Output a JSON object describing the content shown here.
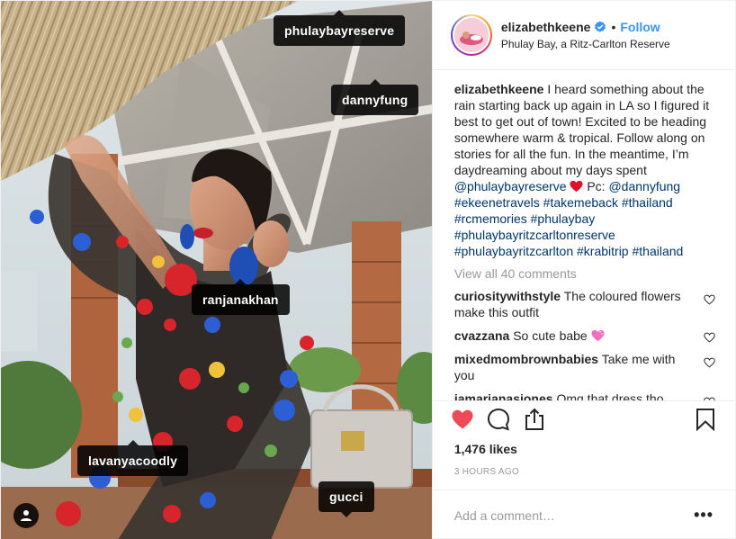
{
  "photo": {
    "tags": {
      "t1": "phulaybayreserve",
      "t2": "dannyfung",
      "t3": "ranjanakhan",
      "t4": "lavanyacoodly",
      "t5": "gucci"
    },
    "user_tag_icon": "person-icon"
  },
  "header": {
    "username": "elizabethkeene",
    "separator": "•",
    "follow": "Follow",
    "location": "Phulay Bay, a Ritz-Carlton Reserve",
    "verified_color": "#3897f0"
  },
  "caption": {
    "username": "elizabethkeene",
    "text": " I heard something about the rain starting back up again in LA so I figured it best to get out of town! Excited to be heading somewhere warm & tropical. Follow along on stories for all the fun. In the meantime, I’m daydreaming about my days spent ",
    "mention1": "@phulaybayreserve",
    "pc": " Pc:",
    "mention2": "@dannyfung",
    "tags": {
      "h1": "#ekeenetravels",
      "h2": "#takemeback",
      "h3": "#thailand",
      "h4": "#rcmemories",
      "h5": "#phulaybay",
      "h6": "#phulaybayritzcarltonreserve",
      "h7": "#phulaybayritzcarlton",
      "h8": "#krabitrip",
      "h9": "#thailand"
    }
  },
  "view_all": "View all 40 comments",
  "comments": [
    {
      "user": "curiositywithstyle",
      "text": " The coloured flowers make this outfit"
    },
    {
      "user": "cvazzana",
      "text": " So cute babe "
    },
    {
      "user": "mixedmombrownbabies",
      "text": " Take me with you"
    },
    {
      "user": "iamarianasjones",
      "text": " Omg that dress tho"
    }
  ],
  "likes": "1,476 likes",
  "time": "3 HOURS AGO",
  "add_comment_placeholder": "Add a comment…",
  "more": "•••",
  "colors": {
    "like_active": "#ed4956",
    "link": "#003569",
    "follow": "#3897f0",
    "muted": "#999999"
  }
}
